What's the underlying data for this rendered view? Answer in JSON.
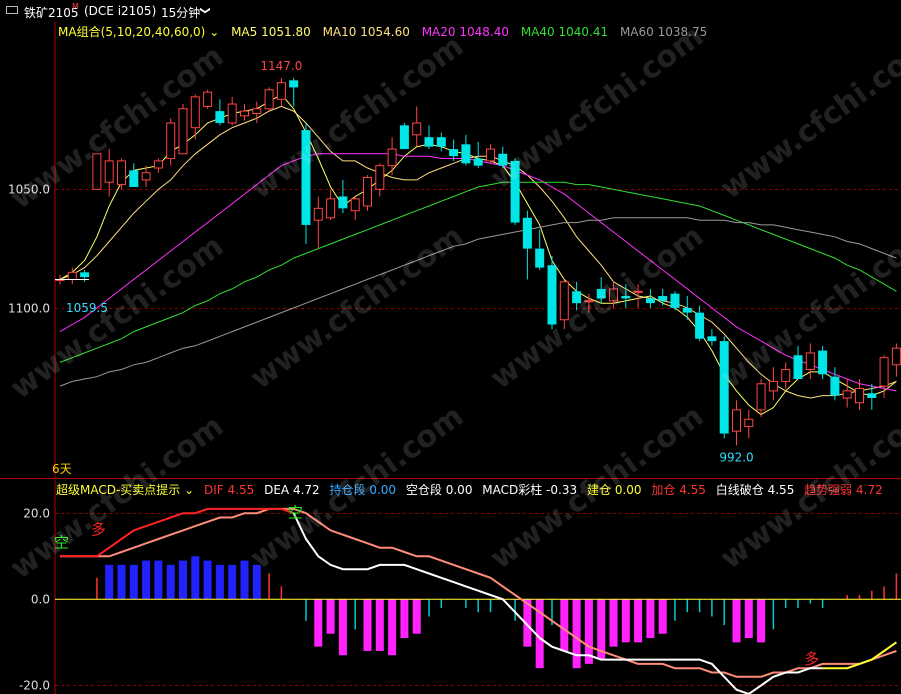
{
  "header": {
    "symbol": "铁矿2105",
    "flag": "M",
    "exchange_code": "(DCE i2105)",
    "period": "15分钟",
    "chevron": "❯"
  },
  "ma_legend": {
    "label": "MA组合(5,10,20,40,60,0)",
    "items": [
      {
        "name": "MA5",
        "value": "1051.80",
        "color": "#ffff66"
      },
      {
        "name": "MA10",
        "value": "1054.60",
        "color": "#ffe080"
      },
      {
        "name": "MA20",
        "value": "1048.40",
        "color": "#ff33ff"
      },
      {
        "name": "MA40",
        "value": "1040.41",
        "color": "#33dd33"
      },
      {
        "name": "MA60",
        "value": "1038.75",
        "color": "#999999"
      }
    ]
  },
  "macd_legend": {
    "label": "超级MACD-买卖点提示",
    "items": [
      {
        "name": "DIF",
        "value": "4.55",
        "color": "#ff3333"
      },
      {
        "name": "DEA",
        "value": "4.72",
        "color": "#ffffff"
      },
      {
        "name": "持仓段",
        "value": "0.00",
        "color": "#33aaff"
      },
      {
        "name": "空仓段",
        "value": "0.00",
        "color": "#ffffff"
      },
      {
        "name": "MACD彩柱",
        "value": "-0.33",
        "color": "#ffffff"
      },
      {
        "name": "建仓",
        "value": "0.00",
        "color": "#ffff33"
      },
      {
        "name": "加仓",
        "value": "4.55",
        "color": "#ff3333"
      },
      {
        "name": "白线破仓",
        "value": "4.55",
        "color": "#ffffff"
      },
      {
        "name": "趋势强弱",
        "value": "4.72",
        "color": "#ff3333"
      }
    ]
  },
  "axis_labels": {
    "price_ticks": [
      "1100.0",
      "1050.0"
    ],
    "macd_ticks": [
      "20.0",
      "0.0",
      "-20.0"
    ],
    "days_label": "6天",
    "high_label": "1147.0",
    "low_label": "992.0",
    "start_label": "1059.5"
  },
  "signals": [
    {
      "text": "空",
      "color": "#22ee22",
      "bar": 0,
      "value": 12
    },
    {
      "text": "多",
      "color": "#ff2222",
      "bar": 3,
      "value": 15
    },
    {
      "text": "空",
      "color": "#22ee22",
      "bar": 19,
      "value": 19
    },
    {
      "text": "多",
      "color": "#ff2222",
      "bar": 61,
      "value": -15
    }
  ],
  "watermark": "www.cfchi.com",
  "colors": {
    "up": "#ff4444",
    "down": "#00e5e5",
    "grid": "#8b0000"
  },
  "chart_data": [
    {
      "type": "candlestick",
      "title": "铁矿2105 15分钟",
      "y_ticks": [
        1050,
        1100
      ],
      "ylim": [
        985,
        1163
      ],
      "ohlc": [
        [
          1062,
          1064,
          1060,
          1062
        ],
        [
          1062,
          1067,
          1060,
          1065
        ],
        [
          1065,
          1066,
          1061,
          1063
        ],
        [
          1100,
          1115,
          1100,
          1115
        ],
        [
          1103,
          1117,
          1097,
          1112
        ],
        [
          1102,
          1113,
          1100,
          1112
        ],
        [
          1108,
          1111,
          1101,
          1101
        ],
        [
          1104,
          1110,
          1101,
          1107
        ],
        [
          1109,
          1113,
          1107,
          1112
        ],
        [
          1113,
          1130,
          1110,
          1128
        ],
        [
          1115,
          1136,
          1115,
          1134
        ],
        [
          1126,
          1140,
          1121,
          1139
        ],
        [
          1135,
          1142,
          1134,
          1141
        ],
        [
          1133,
          1138,
          1127,
          1128
        ],
        [
          1128,
          1139,
          1127,
          1136
        ],
        [
          1131,
          1136,
          1129,
          1133
        ],
        [
          1132,
          1137,
          1128,
          1134
        ],
        [
          1134,
          1143,
          1133,
          1142
        ],
        [
          1138,
          1147,
          1135,
          1145
        ],
        [
          1146,
          1147,
          1135,
          1143
        ],
        [
          1125,
          1128,
          1077,
          1085
        ],
        [
          1087,
          1097,
          1075,
          1092
        ],
        [
          1088,
          1100,
          1087,
          1096
        ],
        [
          1097,
          1104,
          1090,
          1092
        ],
        [
          1091,
          1097,
          1087,
          1096
        ],
        [
          1093,
          1106,
          1091,
          1105
        ],
        [
          1100,
          1111,
          1097,
          1110
        ],
        [
          1110,
          1122,
          1106,
          1117
        ],
        [
          1127,
          1128,
          1117,
          1117
        ],
        [
          1123,
          1135,
          1118,
          1128
        ],
        [
          1122,
          1127,
          1117,
          1118
        ],
        [
          1122,
          1124,
          1116,
          1118
        ],
        [
          1117,
          1121,
          1112,
          1114
        ],
        [
          1119,
          1123,
          1110,
          1111
        ],
        [
          1113,
          1120,
          1109,
          1110
        ],
        [
          1112,
          1119,
          1111,
          1117
        ],
        [
          1115,
          1118,
          1109,
          1110
        ],
        [
          1112,
          1113,
          1085,
          1086
        ],
        [
          1088,
          1091,
          1062,
          1075
        ],
        [
          1075,
          1083,
          1066,
          1067
        ],
        [
          1068,
          1072,
          1041,
          1043
        ],
        [
          1045,
          1062,
          1041,
          1061
        ],
        [
          1057,
          1061,
          1049,
          1052
        ],
        [
          1053,
          1056,
          1048,
          1053
        ],
        [
          1058,
          1063,
          1052,
          1054
        ],
        [
          1053,
          1061,
          1050,
          1058
        ],
        [
          1055,
          1060,
          1050,
          1054
        ],
        [
          1057,
          1060,
          1050,
          1057
        ],
        [
          1054,
          1058,
          1050,
          1052
        ],
        [
          1055,
          1058,
          1051,
          1053
        ],
        [
          1056,
          1057,
          1049,
          1050
        ],
        [
          1050,
          1055,
          1045,
          1048
        ],
        [
          1048,
          1051,
          1036,
          1037
        ],
        [
          1038,
          1041,
          1034,
          1036
        ],
        [
          1036,
          1038,
          995,
          997
        ],
        [
          998,
          1011,
          992,
          1007
        ],
        [
          1000,
          1007,
          995,
          1003
        ],
        [
          1007,
          1020,
          1004,
          1018
        ],
        [
          1015,
          1025,
          1011,
          1019
        ],
        [
          1019,
          1027,
          1016,
          1024
        ],
        [
          1030,
          1034,
          1020,
          1020
        ],
        [
          1024,
          1035,
          1020,
          1031
        ],
        [
          1032,
          1034,
          1020,
          1022
        ],
        [
          1021,
          1025,
          1011,
          1013
        ],
        [
          1012,
          1020,
          1008,
          1015
        ],
        [
          1010,
          1020,
          1007,
          1016
        ],
        [
          1014,
          1018,
          1007,
          1012
        ],
        [
          1017,
          1030,
          1012,
          1029
        ],
        [
          1026,
          1035,
          1021,
          1033
        ]
      ],
      "ma_series": [
        {
          "name": "MA5",
          "values": [
            1062,
            1065,
            1070,
            1080,
            1093,
            1103,
            1108,
            1109,
            1110,
            1116,
            1119,
            1123,
            1128,
            1130,
            1132,
            1133,
            1134,
            1137,
            1140,
            1134,
            1124,
            1113,
            1101,
            1093,
            1097,
            1100,
            1104,
            1108,
            1114,
            1118,
            1119,
            1118,
            1116,
            1115,
            1113,
            1112,
            1110,
            1103,
            1094,
            1085,
            1070,
            1062,
            1057,
            1054,
            1052,
            1052,
            1053,
            1054,
            1055,
            1052,
            1050,
            1046,
            1040,
            1032,
            1022,
            1015,
            1009,
            1005,
            1008,
            1015,
            1020,
            1023,
            1023,
            1020,
            1017,
            1014,
            1013,
            1015,
            1019
          ]
        },
        {
          "name": "MA10",
          "values": [
            1062,
            1064,
            1067,
            1072,
            1078,
            1084,
            1090,
            1095,
            1100,
            1104,
            1110,
            1115,
            1119,
            1123,
            1126,
            1128,
            1130,
            1133,
            1135,
            1133,
            1128,
            1122,
            1116,
            1112,
            1112,
            1109,
            1107,
            1105,
            1104,
            1104,
            1107,
            1109,
            1111,
            1113,
            1114,
            1114,
            1112,
            1110,
            1106,
            1101,
            1095,
            1088,
            1080,
            1074,
            1068,
            1061,
            1058,
            1055,
            1054,
            1053,
            1052,
            1050,
            1047,
            1044,
            1039,
            1033,
            1027,
            1022,
            1018,
            1015,
            1013,
            1012,
            1013,
            1013,
            1014,
            1015,
            1016,
            1017,
            1019
          ]
        },
        {
          "name": "MA20",
          "values": [
            1040,
            1043,
            1046,
            1050,
            1054,
            1058,
            1062,
            1066,
            1070,
            1074,
            1078,
            1082,
            1086,
            1090,
            1094,
            1098,
            1102,
            1106,
            1110,
            1112,
            1114,
            1115,
            1115,
            1115,
            1115,
            1115,
            1115,
            1115,
            1114,
            1114,
            1114,
            1113,
            1113,
            1113,
            1112,
            1111,
            1110,
            1108,
            1106,
            1104,
            1101,
            1098,
            1094,
            1090,
            1086,
            1082,
            1078,
            1074,
            1070,
            1066,
            1062,
            1058,
            1054,
            1050,
            1046,
            1042,
            1039,
            1036,
            1033,
            1030,
            1028,
            1026,
            1024,
            1022,
            1020,
            1018,
            1017,
            1016,
            1015
          ]
        },
        {
          "name": "MA40",
          "values": [
            1027,
            1029,
            1031,
            1033,
            1035,
            1037,
            1040,
            1042,
            1044,
            1046,
            1048,
            1051,
            1053,
            1056,
            1058,
            1061,
            1063,
            1066,
            1068,
            1071,
            1073,
            1075,
            1077,
            1079,
            1081,
            1083,
            1085,
            1087,
            1089,
            1091,
            1093,
            1095,
            1097,
            1099,
            1101,
            1102,
            1103,
            1103,
            1103,
            1103,
            1103,
            1103,
            1102,
            1102,
            1101,
            1100,
            1099,
            1098,
            1097,
            1096,
            1095,
            1094,
            1093,
            1091,
            1089,
            1087,
            1085,
            1083,
            1081,
            1079,
            1077,
            1075,
            1073,
            1071,
            1068,
            1066,
            1063,
            1060,
            1057
          ]
        },
        {
          "name": "MA60",
          "values": [
            1017,
            1019,
            1020,
            1021,
            1023,
            1024,
            1026,
            1027,
            1029,
            1031,
            1033,
            1034,
            1036,
            1038,
            1040,
            1042,
            1044,
            1046,
            1048,
            1050,
            1052,
            1054,
            1056,
            1058,
            1060,
            1062,
            1064,
            1066,
            1068,
            1070,
            1072,
            1074,
            1076,
            1077,
            1079,
            1080,
            1081,
            1082,
            1083,
            1084,
            1085,
            1086,
            1086,
            1087,
            1087,
            1088,
            1088,
            1088,
            1088,
            1088,
            1088,
            1088,
            1087,
            1087,
            1087,
            1086,
            1086,
            1085,
            1085,
            1084,
            1083,
            1082,
            1081,
            1080,
            1078,
            1077,
            1075,
            1073,
            1071
          ]
        }
      ]
    },
    {
      "type": "bar",
      "title": "超级MACD",
      "y_ticks": [
        20,
        0,
        -20
      ],
      "ylim": [
        -22,
        24
      ],
      "histogram": [
        0,
        0,
        0,
        5,
        8,
        8,
        8,
        9,
        9,
        8,
        9,
        10,
        9,
        8,
        8,
        9,
        8,
        6,
        3,
        0,
        -5,
        -11,
        -8,
        -13,
        -7,
        -12,
        -12,
        -13,
        -9,
        -8,
        -4,
        -2,
        0,
        -2,
        -3,
        -3,
        0,
        -5,
        -11,
        -16,
        -6,
        -12,
        -16,
        -15,
        -14,
        -11,
        -10,
        -10,
        -9,
        -8,
        -5,
        -3,
        -3,
        -4,
        -6,
        -10,
        -9,
        -10,
        -7,
        -2,
        -2,
        -1,
        -2,
        0,
        1,
        1,
        2,
        3,
        6
      ],
      "dif": [
        10,
        10,
        10,
        10,
        12,
        14,
        16,
        17,
        18,
        19,
        20,
        20,
        21,
        21,
        21,
        21,
        21,
        21,
        21,
        20,
        14,
        10,
        8,
        7,
        7,
        7,
        8,
        8,
        8,
        7,
        6,
        5,
        4,
        3,
        2,
        1,
        0,
        -3,
        -6,
        -9,
        -11,
        -12,
        -13,
        -13,
        -14,
        -14,
        -14,
        -14,
        -14,
        -14,
        -14,
        -14,
        -14,
        -15,
        -18,
        -21,
        -22,
        -20,
        -18,
        -17,
        -17,
        -16,
        -16,
        -16,
        -16,
        -15,
        -14,
        -12,
        -10
      ],
      "dea": [
        10,
        10,
        10,
        10,
        10,
        11,
        12,
        13,
        14,
        15,
        16,
        17,
        18,
        19,
        19,
        20,
        20,
        21,
        21,
        21,
        20,
        18,
        16,
        15,
        14,
        13,
        12,
        12,
        11,
        10,
        10,
        9,
        8,
        7,
        6,
        5,
        3,
        1,
        -1,
        -3,
        -5,
        -7,
        -9,
        -11,
        -12,
        -13,
        -14,
        -15,
        -15,
        -15,
        -16,
        -16,
        -16,
        -17,
        -17,
        -18,
        -18,
        -18,
        -17,
        -17,
        -16,
        -16,
        -15,
        -15,
        -15,
        -15,
        -14,
        -13,
        -12
      ]
    }
  ]
}
